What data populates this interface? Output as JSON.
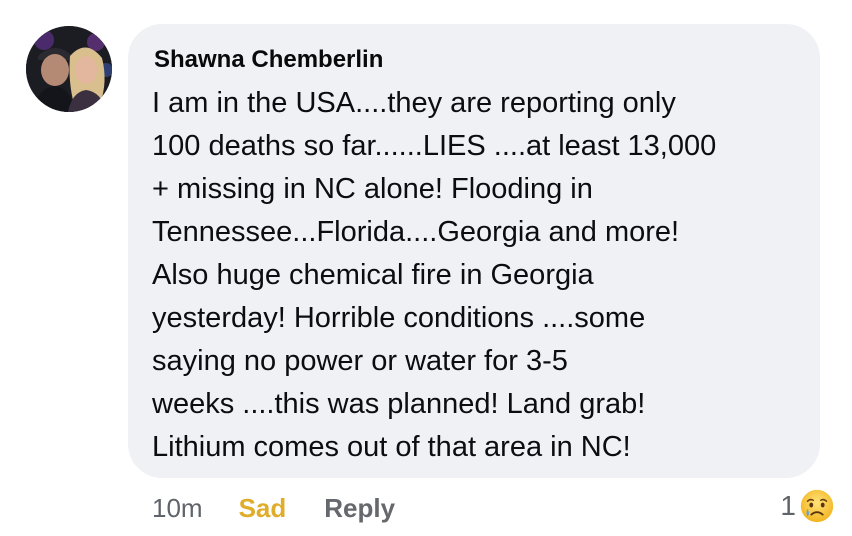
{
  "comment": {
    "author": "Shawna Chemberlin",
    "text": "I am in the USA....they are reporting only\n100 deaths so far......LIES ....at least 13,000\n+ missing in NC alone! Flooding in\nTennessee...Florida....Georgia and more!\nAlso huge chemical fire in Georgia\nyesterday! Horrible conditions ....some\nsaying no power or water for 3-5\nweeks ....this was planned! Land grab!\nLithium comes out of that area in NC!"
  },
  "actions": {
    "time": "10m",
    "reaction_label": "Sad",
    "reply_label": "Reply"
  },
  "reactions": {
    "count": "1",
    "icon": "sad-face-emoji"
  },
  "colors": {
    "bubble": "#eff1f4",
    "sad_reaction": "#e0ad2a",
    "muted_text": "#65686d"
  }
}
